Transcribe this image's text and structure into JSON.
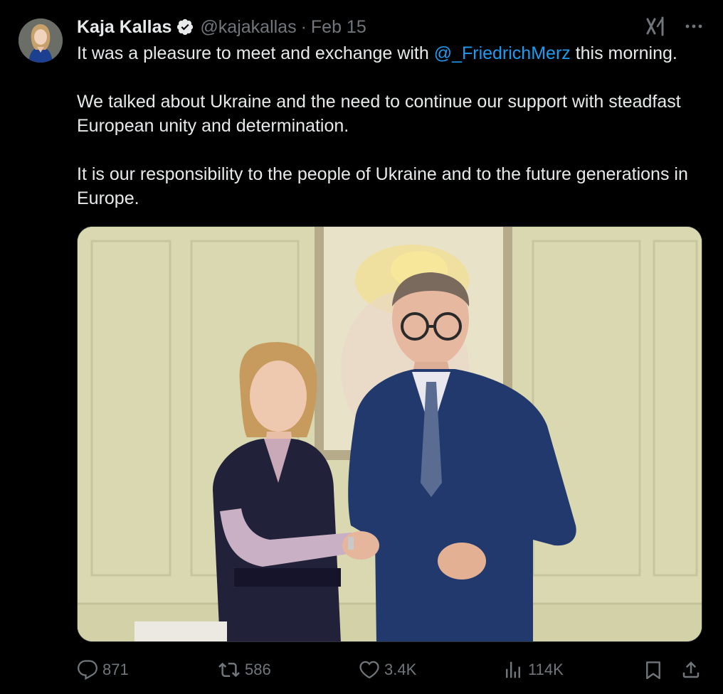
{
  "tweet": {
    "author": {
      "display_name": "Kaja Kallas",
      "handle": "@kajakallas",
      "verified": true,
      "avatar_icon": "profile-photo"
    },
    "separator": "·",
    "date": "Feb 15",
    "text": {
      "p1_before": "It was a pleasure to meet and exchange with ",
      "mention": "@_FriedrichMerz",
      "p1_after": " this morning.",
      "p2": "We talked about Ukraine and the need to continue our support with steadfast European unity and determination.",
      "p3": "It is our responsibility to the people of Ukraine and to the future generations in Europe."
    },
    "media": {
      "type": "photo"
    },
    "top_actions": {
      "grok_icon": "grok-icon",
      "more_icon": "more-icon"
    },
    "actions": {
      "replies": "871",
      "reposts": "586",
      "likes": "3.4K",
      "views": "114K"
    }
  },
  "colors": {
    "background": "#000000",
    "text": "#e7e9ea",
    "secondary": "#71767b",
    "link": "#1d9bf0",
    "border": "#2f3336"
  }
}
